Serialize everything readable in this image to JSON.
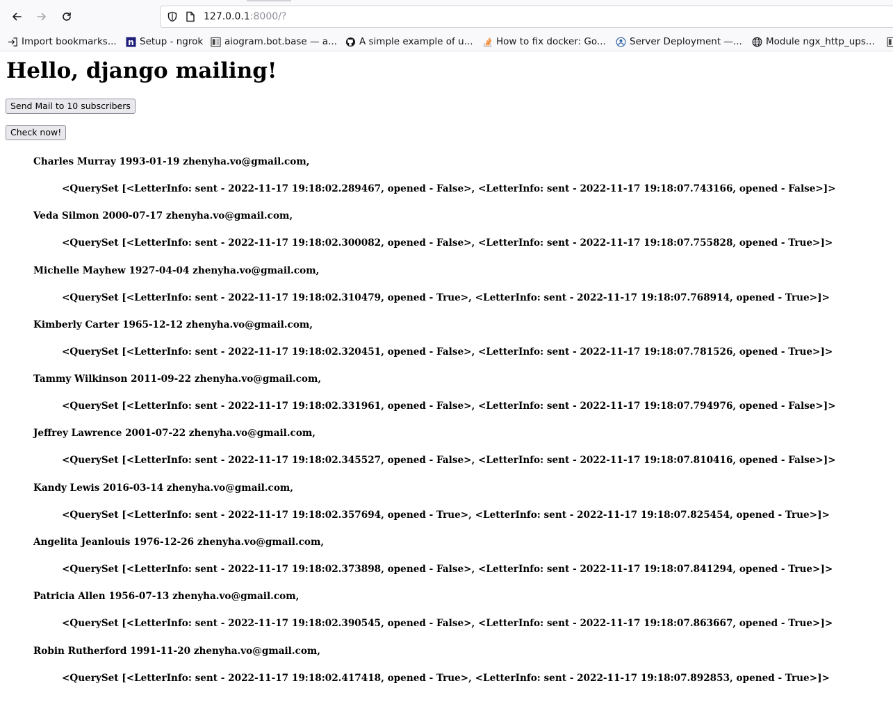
{
  "browser": {
    "url_host": "127.0.0.1",
    "url_rest": ":8000/?",
    "bookmarks": [
      {
        "label": "Import bookmarks..."
      },
      {
        "label": "Setup - ngrok"
      },
      {
        "label": "aiogram.bot.base — a..."
      },
      {
        "label": "A simple example of u..."
      },
      {
        "label": "How to fix docker: Go..."
      },
      {
        "label": "Server Deployment —..."
      },
      {
        "label": "Module ngx_http_ups..."
      }
    ]
  },
  "page": {
    "title": "Hello, django mailing!",
    "send_button_label": "Send Mail to 10 subscribers",
    "check_button_label": "Check now!",
    "subscribers": [
      {
        "line": "Charles Murray 1993-01-19 zhenyha.vo@gmail.com,",
        "letters": "<QuerySet [<LetterInfo: sent - 2022-11-17 19:18:02.289467, opened - False>, <LetterInfo: sent - 2022-11-17 19:18:07.743166, opened - False>]>"
      },
      {
        "line": "Veda Silmon 2000-07-17 zhenyha.vo@gmail.com,",
        "letters": "<QuerySet [<LetterInfo: sent - 2022-11-17 19:18:02.300082, opened - False>, <LetterInfo: sent - 2022-11-17 19:18:07.755828, opened - True>]>"
      },
      {
        "line": "Michelle Mayhew 1927-04-04 zhenyha.vo@gmail.com,",
        "letters": "<QuerySet [<LetterInfo: sent - 2022-11-17 19:18:02.310479, opened - True>, <LetterInfo: sent - 2022-11-17 19:18:07.768914, opened - True>]>"
      },
      {
        "line": "Kimberly Carter 1965-12-12 zhenyha.vo@gmail.com,",
        "letters": "<QuerySet [<LetterInfo: sent - 2022-11-17 19:18:02.320451, opened - False>, <LetterInfo: sent - 2022-11-17 19:18:07.781526, opened - True>]>"
      },
      {
        "line": "Tammy Wilkinson 2011-09-22 zhenyha.vo@gmail.com,",
        "letters": "<QuerySet [<LetterInfo: sent - 2022-11-17 19:18:02.331961, opened - False>, <LetterInfo: sent - 2022-11-17 19:18:07.794976, opened - False>]>"
      },
      {
        "line": "Jeffrey Lawrence 2001-07-22 zhenyha.vo@gmail.com,",
        "letters": "<QuerySet [<LetterInfo: sent - 2022-11-17 19:18:02.345527, opened - False>, <LetterInfo: sent - 2022-11-17 19:18:07.810416, opened - False>]>"
      },
      {
        "line": "Kandy Lewis 2016-03-14 zhenyha.vo@gmail.com,",
        "letters": "<QuerySet [<LetterInfo: sent - 2022-11-17 19:18:02.357694, opened - True>, <LetterInfo: sent - 2022-11-17 19:18:07.825454, opened - True>]>"
      },
      {
        "line": "Angelita Jeanlouis 1976-12-26 zhenyha.vo@gmail.com,",
        "letters": "<QuerySet [<LetterInfo: sent - 2022-11-17 19:18:02.373898, opened - False>, <LetterInfo: sent - 2022-11-17 19:18:07.841294, opened - True>]>"
      },
      {
        "line": "Patricia Allen 1956-07-13 zhenyha.vo@gmail.com,",
        "letters": "<QuerySet [<LetterInfo: sent - 2022-11-17 19:18:02.390545, opened - False>, <LetterInfo: sent - 2022-11-17 19:18:07.863667, opened - True>]>"
      },
      {
        "line": "Robin Rutherford 1991-11-20 zhenyha.vo@gmail.com,",
        "letters": "<QuerySet [<LetterInfo: sent - 2022-11-17 19:18:02.417418, opened - True>, <LetterInfo: sent - 2022-11-17 19:18:07.892853, opened - True>]>"
      }
    ]
  }
}
